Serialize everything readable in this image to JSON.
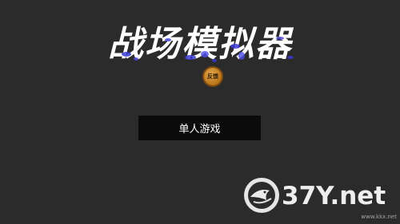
{
  "title": "战场模拟器",
  "feedback_badge": {
    "label": "反馈"
  },
  "menu": {
    "single_player": "单人游戏"
  },
  "watermark": {
    "brand": "37Y.net",
    "url": "www.kkx.net"
  },
  "colors": {
    "background": "#2b2b2b",
    "button": "#0b0b0b",
    "badge": "#c98a2c",
    "title": "#ffffff",
    "title_accent": "#3a3ad6"
  }
}
